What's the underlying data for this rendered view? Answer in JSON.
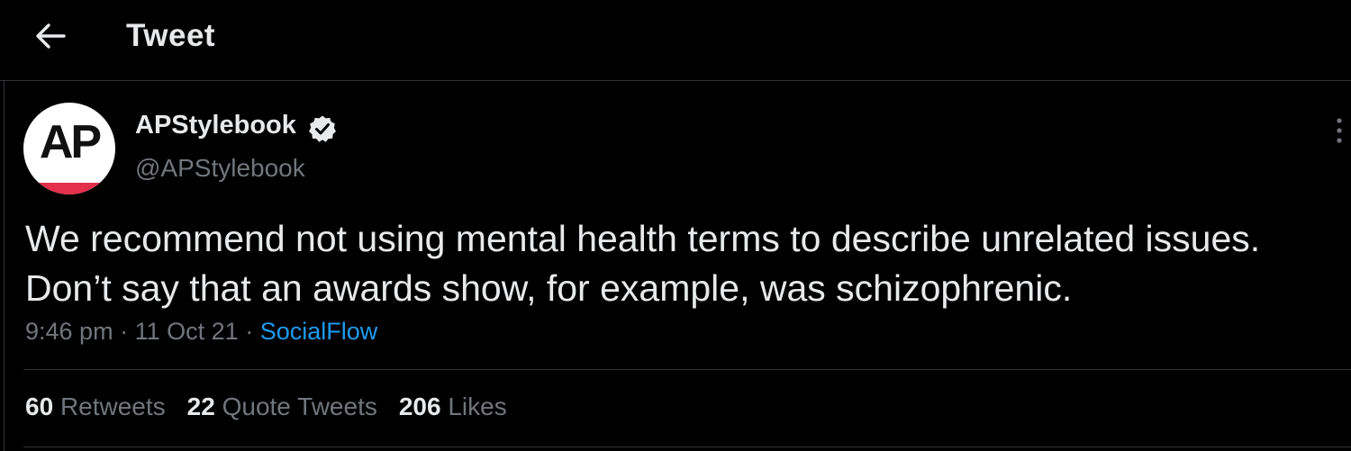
{
  "header": {
    "title": "Tweet",
    "back_icon": "arrow-left-icon"
  },
  "author": {
    "avatar_text": "AP",
    "display_name": "APStylebook",
    "verified_icon": "verified-badge-icon",
    "handle": "@APStylebook"
  },
  "tweet": {
    "lines": [
      "We recommend not using mental health terms to describe unrelated issues.",
      "Don’t say that an awards show, for example, was schizophrenic."
    ],
    "time": "9:46 pm",
    "separator": "·",
    "date": "11 Oct 21",
    "source": "SocialFlow"
  },
  "stats": {
    "retweets_count": "60",
    "retweets_label": "Retweets",
    "quotes_count": "22",
    "quotes_label": "Quote Tweets",
    "likes_count": "206",
    "likes_label": "Likes"
  },
  "colors": {
    "background": "#000000",
    "text": "#e7e9ea",
    "muted": "#71767b",
    "link": "#1d9bf0",
    "avatar_stripe": "#e4304b"
  }
}
